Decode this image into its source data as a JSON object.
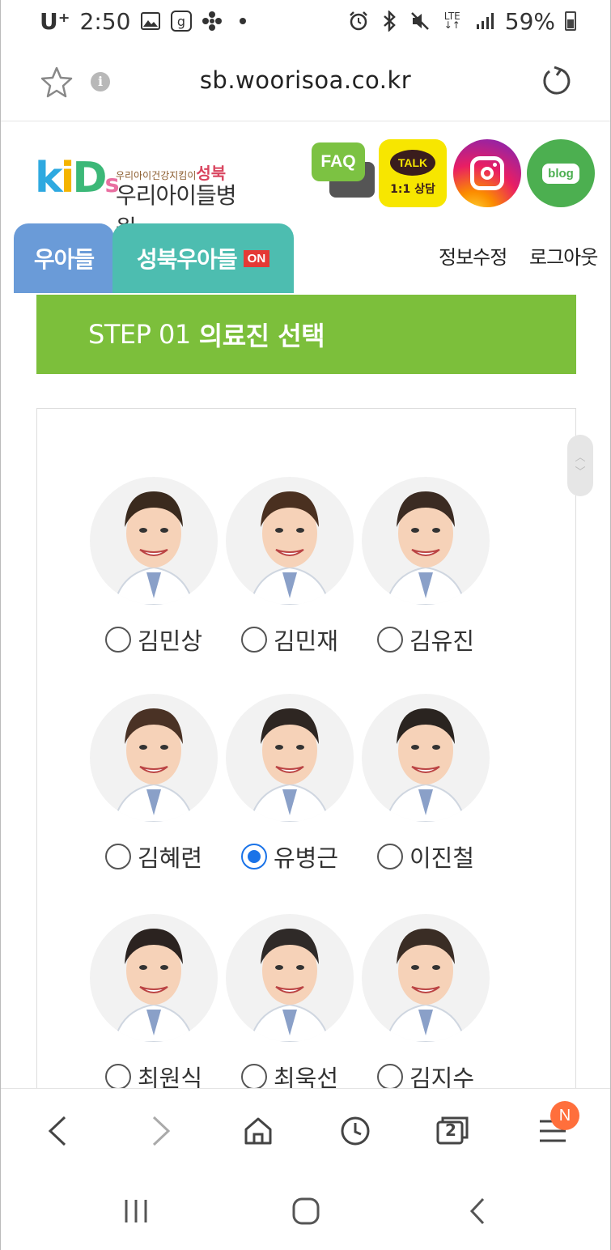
{
  "status_bar": {
    "carrier": "U⁺",
    "time": "2:50",
    "battery": "59%",
    "network": "LTE",
    "icons": [
      "gallery-icon",
      "g-app-icon",
      "fan-icon",
      "dot-icon",
      "alarm-icon",
      "bluetooth-icon",
      "mute-icon",
      "lte-icon",
      "signal-icon",
      "battery-icon"
    ]
  },
  "browser": {
    "url": "sb.woorisoa.co.kr"
  },
  "header": {
    "logo_kids": "kids",
    "logo_small": "우리아이건강지킴이",
    "logo_region": "성북",
    "logo_name": "우리아이들병원",
    "faq_label": "FAQ",
    "talk_label": "TALK",
    "talk_sub": "1:1 상담",
    "blog_label": "blog"
  },
  "tabs": [
    {
      "label": "우아들"
    },
    {
      "label": "성북우아들",
      "badge": "ON"
    }
  ],
  "top_links": {
    "edit": "정보수정",
    "logout": "로그아웃"
  },
  "step": {
    "prefix": "STEP 01",
    "title": "의료진 선택"
  },
  "doctors": [
    {
      "name": "김민상",
      "selected": false
    },
    {
      "name": "김민재",
      "selected": false
    },
    {
      "name": "김유진",
      "selected": false
    },
    {
      "name": "김혜련",
      "selected": false
    },
    {
      "name": "유병근",
      "selected": true
    },
    {
      "name": "이진철",
      "selected": false
    },
    {
      "name": "최원식",
      "selected": false
    },
    {
      "name": "최욱선",
      "selected": false
    },
    {
      "name": "김지수",
      "selected": false
    }
  ],
  "browser_bar": {
    "tab_count": "2",
    "menu_badge": "N"
  },
  "colors": {
    "step_green": "#7cbf3b",
    "tab_blue": "#6a9bd8",
    "tab_teal": "#4dbdb0",
    "radio_selected": "#1a73e8",
    "badge_orange": "#ff6f3c"
  }
}
